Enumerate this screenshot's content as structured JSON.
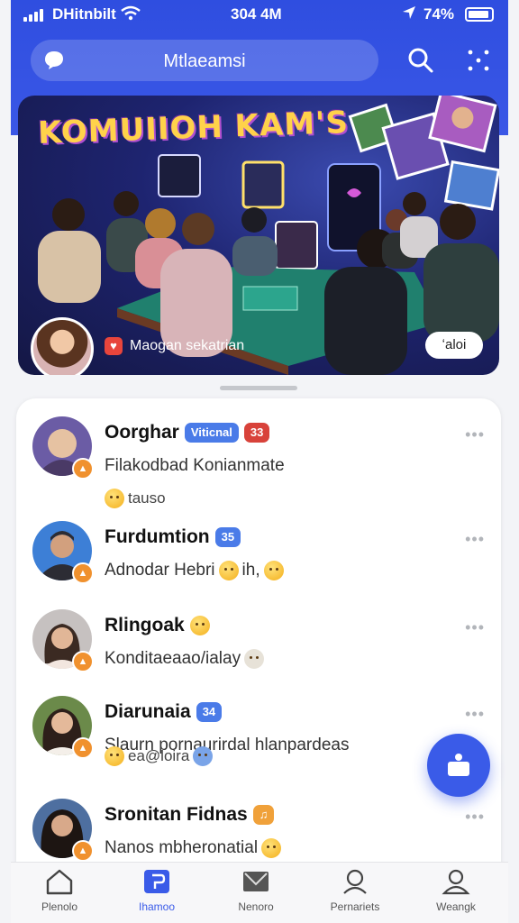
{
  "status_bar": {
    "carrier": "DHitnbilt",
    "time": "304 4M",
    "battery_text": "74%"
  },
  "header": {
    "title": "Mtlaeamsi"
  },
  "banner": {
    "title": "KOMUIIOH KAM'S",
    "caption": "Maogan sekatrian",
    "pill_label": "ʻaloi"
  },
  "chats": [
    {
      "name": "Oorghar",
      "tags": [
        {
          "text": "Viticnal",
          "color": "blue"
        },
        {
          "text": "33",
          "color": "red"
        }
      ],
      "message": "Filakodbad Konianmate",
      "sub": "tauso",
      "avatar_colors": [
        "#4a3a66",
        "#e6c2a2",
        "#6b5ca5"
      ]
    },
    {
      "name": "Furdumtion",
      "tags": [
        {
          "text": "35",
          "color": "blue"
        }
      ],
      "message": "Adnodar Hebri",
      "message_tail": "ih,",
      "sub": "",
      "avatar_colors": [
        "#2c2c34",
        "#d2a07e",
        "#3d7fd6"
      ]
    },
    {
      "name": "Rlingoak",
      "tags": [],
      "message": "Konditaeaao/ialay",
      "sub": "",
      "avatar_colors": [
        "#3b2a22",
        "#e1b697",
        "#c6c1c0"
      ]
    },
    {
      "name": "Diarunaia",
      "tags": [
        {
          "text": "34",
          "color": "blue"
        }
      ],
      "message": "Slaurn pornaurirdal hlanpardeas",
      "sub": "ea@loira",
      "avatar_colors": [
        "#2d1f1a",
        "#e4b99a",
        "#6b8a4a"
      ]
    },
    {
      "name": "Sronitan Fidnas",
      "tags": [
        {
          "text": "♫",
          "color": "orange"
        }
      ],
      "message": "Nanos mbheronatial",
      "sub": "",
      "avatar_colors": [
        "#1d1512",
        "#d8a98a",
        "#4e6fa0"
      ]
    }
  ],
  "nav": [
    {
      "label": "Plenolo",
      "icon": "home-icon"
    },
    {
      "label": "Ihamoo",
      "icon": "chat-icon",
      "active": true
    },
    {
      "label": "Nenoro",
      "icon": "envelope-icon"
    },
    {
      "label": "Pernariets",
      "icon": "people-icon"
    },
    {
      "label": "Weangk",
      "icon": "profile-icon"
    }
  ]
}
